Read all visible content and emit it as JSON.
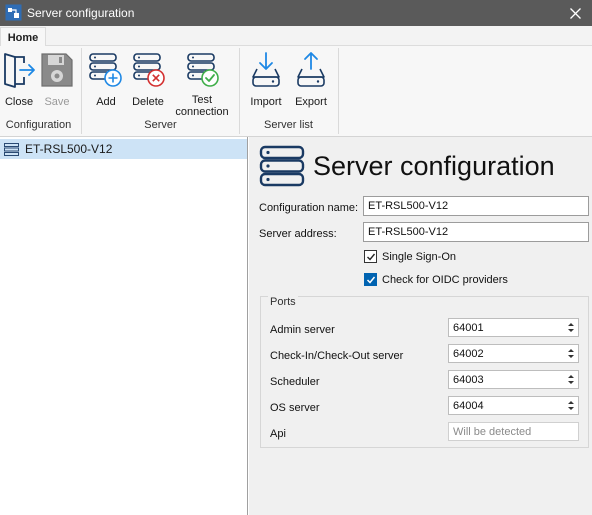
{
  "window": {
    "title": "Server configuration"
  },
  "tabs": [
    {
      "label": "Home"
    }
  ],
  "ribbon": {
    "groups": [
      {
        "label": "Configuration",
        "buttons": [
          {
            "label": "Close",
            "icon": "exit-door-icon"
          },
          {
            "label": "Save",
            "icon": "floppy-disk-icon",
            "disabled": true
          }
        ]
      },
      {
        "label": "Server",
        "buttons": [
          {
            "label": "Add",
            "icon": "server-add-icon"
          },
          {
            "label": "Delete",
            "icon": "server-delete-icon"
          },
          {
            "label_line1": "Test",
            "label_line2": "connection",
            "icon": "server-check-icon"
          }
        ]
      },
      {
        "label": "Server list",
        "buttons": [
          {
            "label": "Import",
            "icon": "import-drive-icon"
          },
          {
            "label": "Export",
            "icon": "export-drive-icon"
          }
        ]
      }
    ]
  },
  "tree": {
    "items": [
      {
        "label": "ET-RSL500-V12",
        "icon": "server-list-icon",
        "selected": true
      }
    ]
  },
  "main": {
    "title": "Server configuration",
    "config_name": {
      "label": "Configuration name:",
      "value": "ET-RSL500-V12"
    },
    "server_address": {
      "label": "Server address:",
      "value": "ET-RSL500-V12"
    },
    "single_sign_on": {
      "label": "Single Sign-On",
      "checked": true
    },
    "oidc": {
      "label": "Check for OIDC providers",
      "checked": true
    },
    "ports": {
      "title": "Ports",
      "rows": [
        {
          "label": "Admin server",
          "value": "64001"
        },
        {
          "label": "Check-In/Check-Out server",
          "value": "64002"
        },
        {
          "label": "Scheduler",
          "value": "64003"
        },
        {
          "label": "OS server",
          "value": "64004"
        },
        {
          "label": "Api",
          "value": "",
          "placeholder": "Will be detected"
        }
      ]
    }
  },
  "colors": {
    "titlebar": "#5a5a5a",
    "accent": "#0063b1",
    "selection": "#cde3f6",
    "add": "#1e88e5",
    "delete": "#d32f2f",
    "check": "#3fae49"
  }
}
